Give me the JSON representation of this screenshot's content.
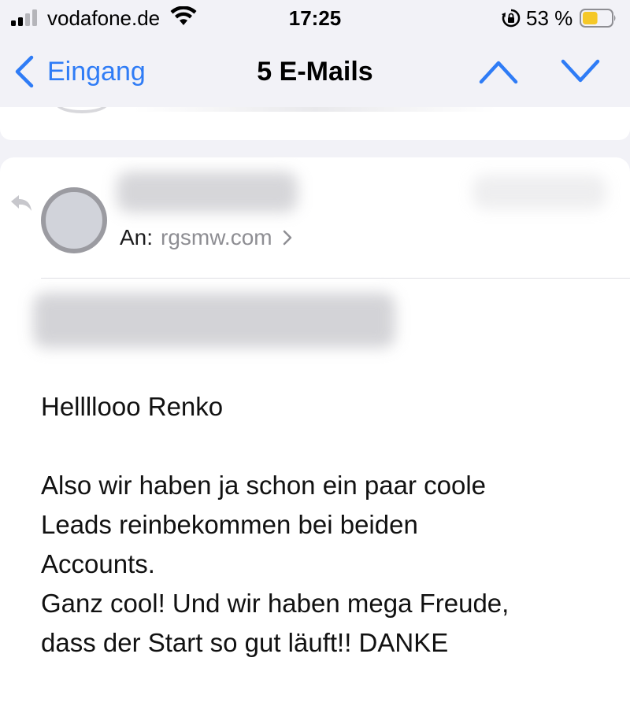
{
  "status_bar": {
    "carrier": "vodafone.de",
    "time": "17:25",
    "battery_percent": "53 %",
    "battery_level": 0.53,
    "icons": [
      "signal-icon",
      "wifi-icon",
      "rotation-lock-icon",
      "battery-icon"
    ]
  },
  "nav": {
    "back_label": "Eingang",
    "title": "5 E-Mails",
    "icons": [
      "chevron-left-icon",
      "chevron-up-icon",
      "chevron-down-icon"
    ],
    "accent_color": "#2f7cf6"
  },
  "message": {
    "recipient_label": "An:",
    "recipient_address": "rgsmw.com",
    "body": {
      "greeting": "Hellllooo Renko",
      "line1": "Also wir haben ja schon ein paar coole",
      "line2": "Leads reinbekommen bei beiden",
      "line3": "Accounts.",
      "line4": "Ganz cool! Und wir haben mega Freude,",
      "line5": "dass der Start so gut läuft!! DANKE"
    }
  }
}
